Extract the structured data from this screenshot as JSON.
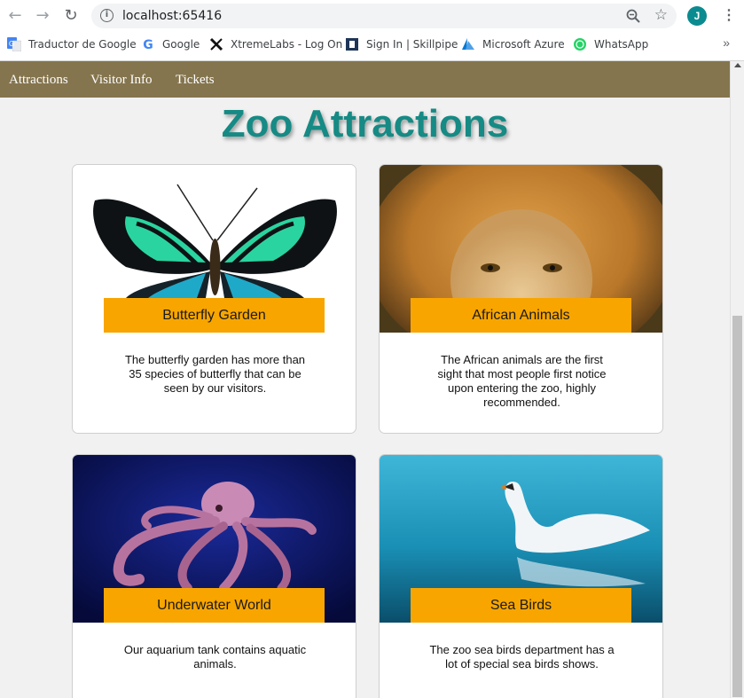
{
  "browser": {
    "url": "localhost:65416",
    "avatar_letter": "J",
    "bookmarks": [
      {
        "label": "Traductor de Google",
        "icon": "google-translate-icon"
      },
      {
        "label": "Google",
        "icon": "google-icon"
      },
      {
        "label": "XtremeLabs - Log On",
        "icon": "xtremelabs-icon"
      },
      {
        "label": "Sign In | Skillpipe",
        "icon": "skillpipe-icon"
      },
      {
        "label": "Microsoft Azure",
        "icon": "azure-icon"
      },
      {
        "label": "WhatsApp",
        "icon": "whatsapp-icon"
      }
    ],
    "more_label": "»"
  },
  "nav": {
    "items": [
      "Attractions",
      "Visitor Info",
      "Tickets"
    ],
    "background": "#85754e"
  },
  "page": {
    "title": "Zoo Attractions",
    "title_color": "#168a84",
    "accent": "#f8a500"
  },
  "cards": [
    {
      "title": "Butterfly Garden",
      "image": "butterfly",
      "description": "The butterfly garden has more than 35 species of butterfly that can be seen by our visitors."
    },
    {
      "title": "African Animals",
      "image": "lion",
      "description": "The African animals are the first sight that most people first notice upon entering the zoo, highly recommended."
    },
    {
      "title": "Underwater World",
      "image": "octopus",
      "description": "Our aquarium tank contains aquatic animals."
    },
    {
      "title": "Sea Birds",
      "image": "swan",
      "description": "The zoo sea birds department has a lot of special sea birds shows."
    }
  ]
}
